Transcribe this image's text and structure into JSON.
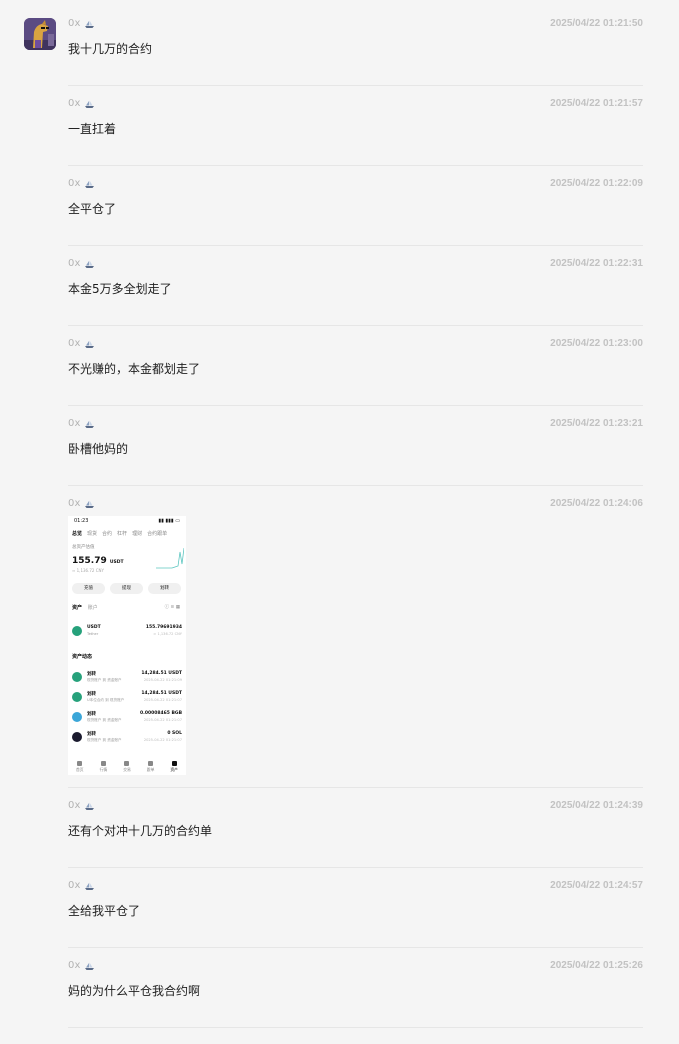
{
  "messages": [
    {
      "sender": "0x",
      "time": "2025/04/22 01:21:50",
      "text": "我十几万的合约"
    },
    {
      "sender": "0x",
      "time": "2025/04/22 01:21:57",
      "text": "一直扛着"
    },
    {
      "sender": "0x",
      "time": "2025/04/22 01:22:09",
      "text": "全平仓了"
    },
    {
      "sender": "0x",
      "time": "2025/04/22 01:22:31",
      "text": "本金5万多全划走了"
    },
    {
      "sender": "0x",
      "time": "2025/04/22 01:23:00",
      "text": "不光赚的，本金都划走了"
    },
    {
      "sender": "0x",
      "time": "2025/04/22 01:23:21",
      "text": "卧槽他妈的"
    },
    {
      "sender": "0x",
      "time": "2025/04/22 01:24:06",
      "text": ""
    },
    {
      "sender": "0x",
      "time": "2025/04/22 01:24:39",
      "text": "还有个对冲十几万的合约单"
    },
    {
      "sender": "0x",
      "time": "2025/04/22 01:24:57",
      "text": "全给我平仓了"
    },
    {
      "sender": "0x",
      "time": "2025/04/22 01:25:26",
      "text": "妈的为什么平仓我合约啊"
    }
  ],
  "screenshot": {
    "status_time": "01:23",
    "tabs": [
      "总览",
      "现货",
      "合约",
      "杠杆",
      "理财",
      "合约跟单"
    ],
    "asset_label": "总资产估值",
    "balance": "155.79",
    "balance_unit": "USDT",
    "balance_cny": "≈ 1,136.72 CNY",
    "buttons": [
      "充值",
      "提现",
      "划转"
    ],
    "section_assets": "资产",
    "section_accounts": "账户",
    "asset_row": {
      "name": "USDT",
      "sub": "Tether",
      "value": "155.79691934",
      "cny": "≈ 1,136.72 CNY"
    },
    "section_activity": "资产动态",
    "activities": [
      {
        "name": "划转",
        "sub": "现货账户 到 资金账户",
        "value": "14,284.51 USDT",
        "date": "2025-04-22 01:21:09",
        "color": "#26a17b"
      },
      {
        "name": "划转",
        "sub": "U本位合约 到 现货账户",
        "value": "14,284.51 USDT",
        "date": "2025-04-22 01:21:07",
        "color": "#26a17b"
      },
      {
        "name": "划转",
        "sub": "现货账户 到 资金账户",
        "value": "0.00008465 BGB",
        "date": "2025-04-22 01:21:07",
        "color": "#3aa6d8"
      },
      {
        "name": "划转",
        "sub": "现货账户 到 资金账户",
        "value": "0 SOL",
        "date": "2025-04-22 01:21:07",
        "color": "#1a1a2e"
      }
    ],
    "nav": [
      "首页",
      "行情",
      "交易",
      "跟单",
      "资产"
    ]
  },
  "colors": {
    "background": "#f5f5f5",
    "divider": "#e6e6e6",
    "meta": "#b3b3b3",
    "tether": "#26a17b",
    "chart_line": "#5cc6c0"
  }
}
